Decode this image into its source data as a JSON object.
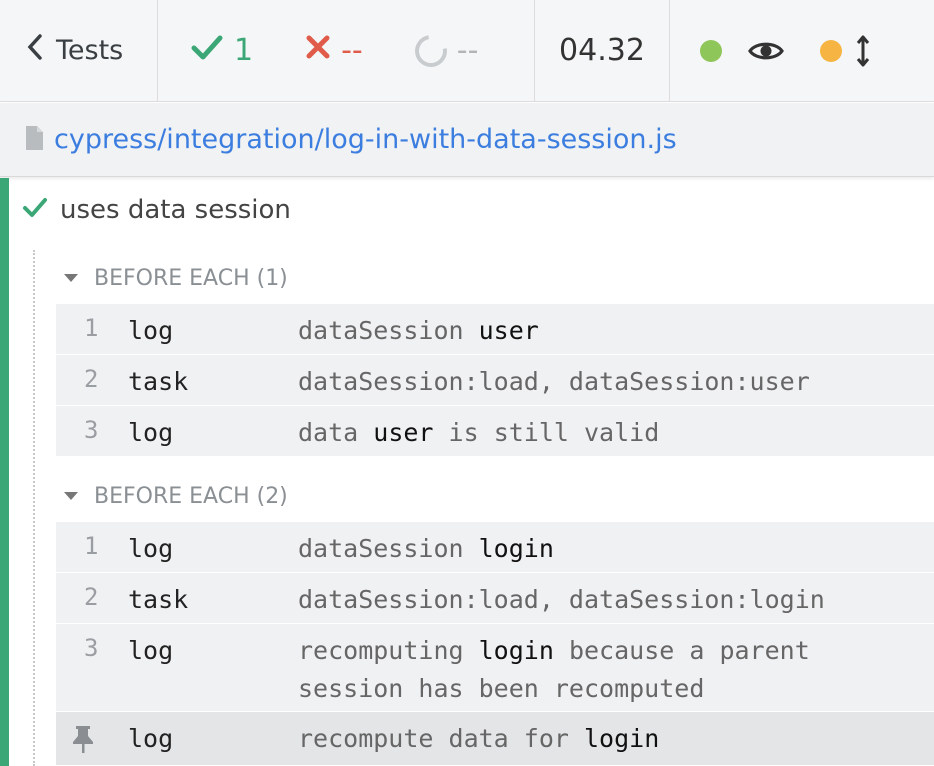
{
  "header": {
    "back_label": "Tests",
    "passed_count": "1",
    "failed_count": "--",
    "pending_count": "--",
    "duration": "04.32",
    "colors": {
      "passed": "#3ba776",
      "failed": "#e05b4a",
      "status_dot": "#8fc659",
      "scroll_dot": "#f6b442"
    }
  },
  "spec": {
    "path": "cypress/integration/log-in-with-data-session.js"
  },
  "test": {
    "title": "uses data session"
  },
  "hooks": [
    {
      "title": "BEFORE EACH (1)",
      "commands": [
        {
          "num": "1",
          "name": "log",
          "msg_parts": [
            "dataSession ",
            "user",
            ""
          ]
        },
        {
          "num": "2",
          "name": "task",
          "msg_parts": [
            "dataSession:load, dataSession:user",
            "",
            ""
          ]
        },
        {
          "num": "3",
          "name": "log",
          "msg_parts": [
            "data ",
            "user",
            " is still valid"
          ]
        }
      ]
    },
    {
      "title": "BEFORE EACH (2)",
      "commands": [
        {
          "num": "1",
          "name": "log",
          "msg_parts": [
            "dataSession ",
            "login",
            ""
          ]
        },
        {
          "num": "2",
          "name": "task",
          "msg_parts": [
            "dataSession:load, dataSession:login",
            "",
            ""
          ]
        },
        {
          "num": "3",
          "name": "log",
          "msg_parts": [
            "recomputing ",
            "login",
            " because a parent"
          ],
          "msg_line2": "session has been recomputed"
        },
        {
          "num": "",
          "name": "log",
          "pinned": true,
          "msg_parts": [
            "recompute data for ",
            "login",
            ""
          ]
        }
      ]
    }
  ]
}
